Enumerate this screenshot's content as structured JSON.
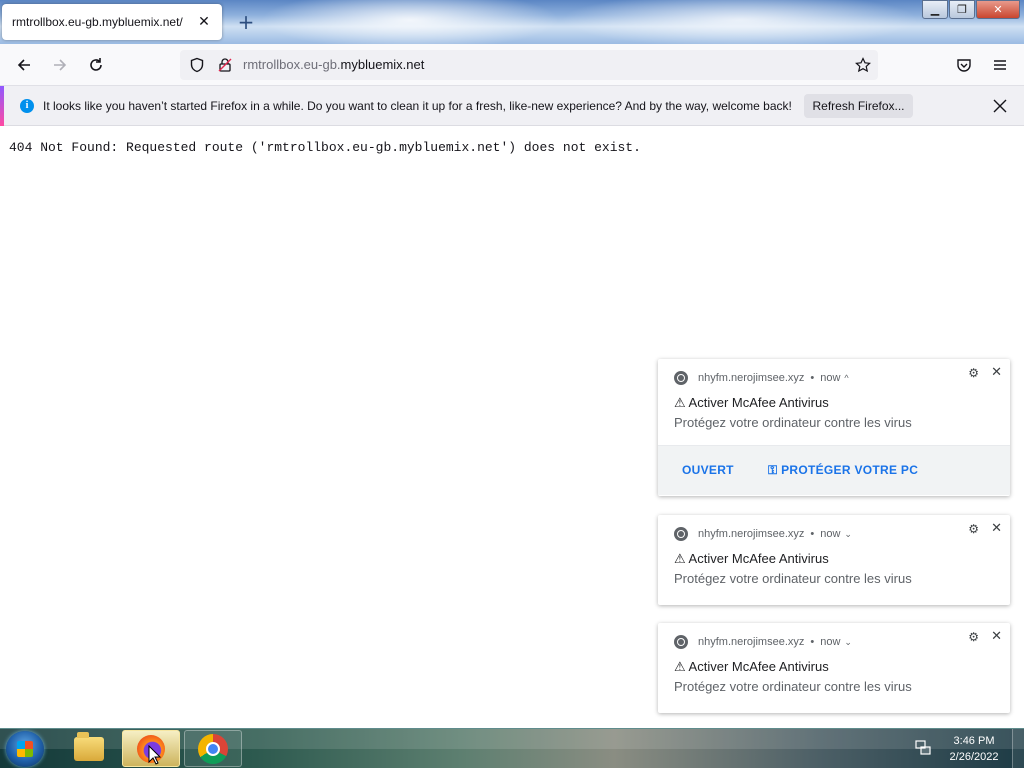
{
  "browser": {
    "tab": {
      "title": "rmtrollbox.eu-gb.mybluemix.net/"
    },
    "url": {
      "prefix": "rmtrollbox.eu-gb.",
      "domain": "mybluemix.net"
    }
  },
  "infobar": {
    "message": "It looks like you haven’t started Firefox in a while. Do you want to clean it up for a fresh, like-new experience? And by the way, welcome back!",
    "button": "Refresh Firefox...",
    "icon": "info-icon"
  },
  "page": {
    "error": "404 Not Found: Requested route ('rmtrollbox.eu-gb.mybluemix.net') does not exist."
  },
  "notifications": [
    {
      "source": "nhyfm.nerojimsee.xyz",
      "time": "now",
      "chevron": "^",
      "title": "⚠ Activer McAfee Antivirus",
      "body": "Protégez votre ordinateur contre les virus",
      "actions": [
        "OUVERT",
        "⚿ PROTÉGER VOTRE PC"
      ]
    },
    {
      "source": "nhyfm.nerojimsee.xyz",
      "time": "now",
      "chevron": "⌄",
      "title": "⚠ Activer McAfee Antivirus",
      "body": "Protégez votre ordinateur contre les virus"
    },
    {
      "source": "nhyfm.nerojimsee.xyz",
      "time": "now",
      "chevron": "⌄",
      "title": "⚠ Activer McAfee Antivirus",
      "body": "Protégez votre ordinateur contre les virus"
    }
  ],
  "taskbar": {
    "apps": [
      "explorer",
      "firefox",
      "chrome"
    ],
    "active_app": "firefox",
    "clock": {
      "time": "3:46 PM",
      "date": "2/26/2022"
    }
  },
  "colors": {
    "accent_blue": "#0090ed",
    "notification_action": "#1a73e8"
  }
}
